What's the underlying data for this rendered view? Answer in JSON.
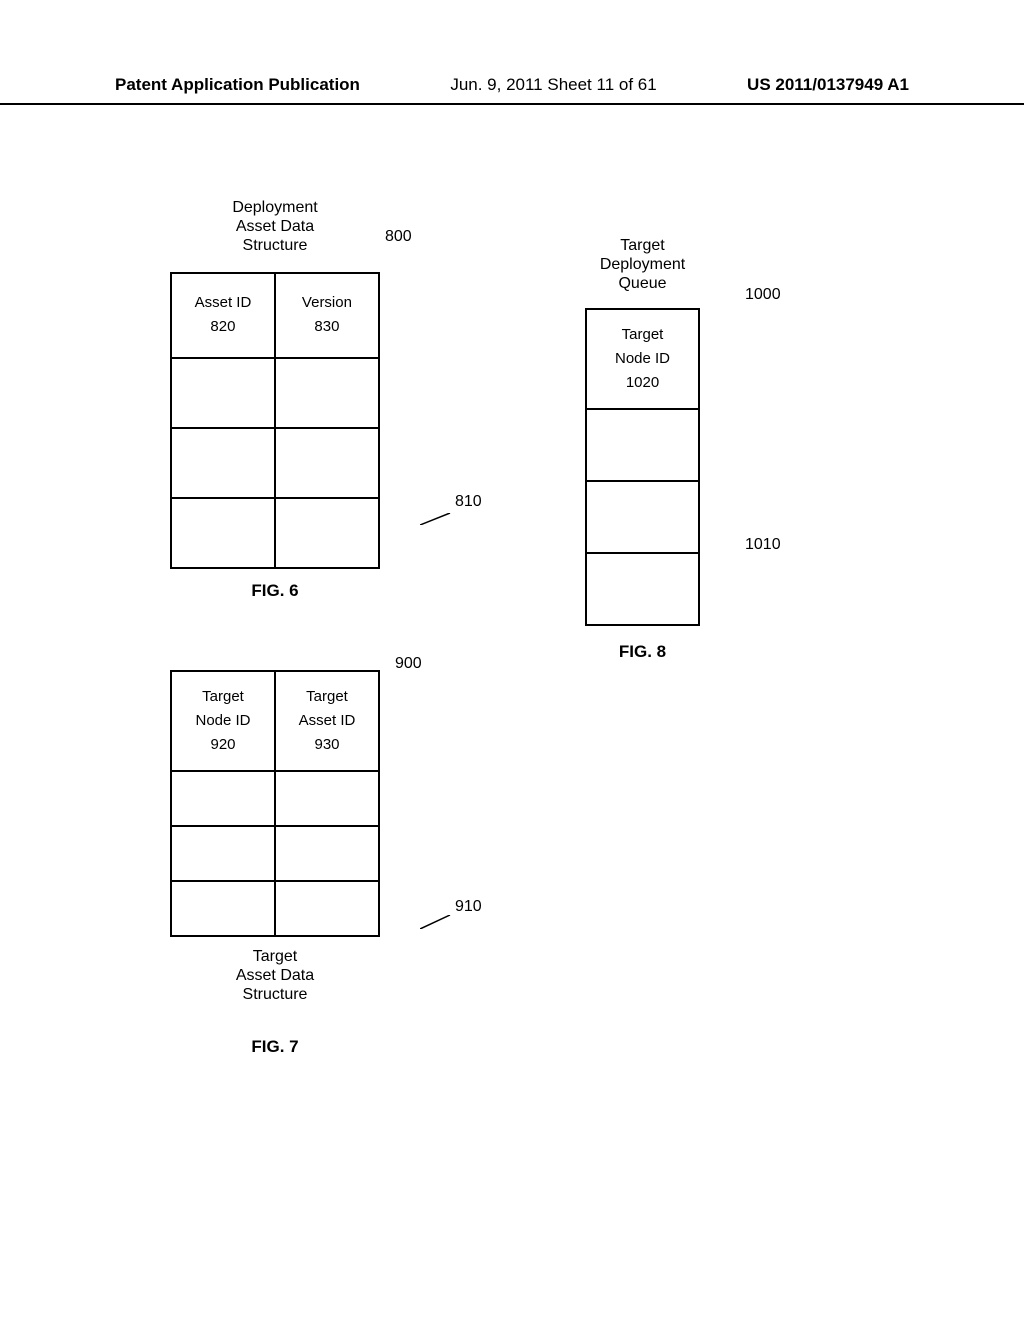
{
  "header": {
    "left": "Patent Application Publication",
    "center": "Jun. 9, 2011  Sheet 11 of 61",
    "right": "US 2011/0137949 A1"
  },
  "fig6": {
    "title_l1": "Deployment",
    "title_l2": "Asset Data",
    "title_l3": "Structure",
    "ref": "800",
    "col1_header": "Asset ID",
    "col1_num": "820",
    "col2_header": "Version",
    "col2_num": "830",
    "row_ref": "810",
    "caption": "FIG. 6"
  },
  "fig7": {
    "ref": "900",
    "col1_header_l1": "Target",
    "col1_header_l2": "Node ID",
    "col1_num": "920",
    "col2_header_l1": "Target",
    "col2_header_l2": "Asset ID",
    "col2_num": "930",
    "row_ref": "910",
    "title_l1": "Target",
    "title_l2": "Asset Data",
    "title_l3": "Structure",
    "caption": "FIG. 7"
  },
  "fig8": {
    "title_l1": "Target",
    "title_l2": "Deployment",
    "title_l3": "Queue",
    "ref": "1000",
    "col1_header_l1": "Target",
    "col1_header_l2": "Node ID",
    "col1_num": "1020",
    "row_ref": "1010",
    "caption": "FIG. 8"
  }
}
